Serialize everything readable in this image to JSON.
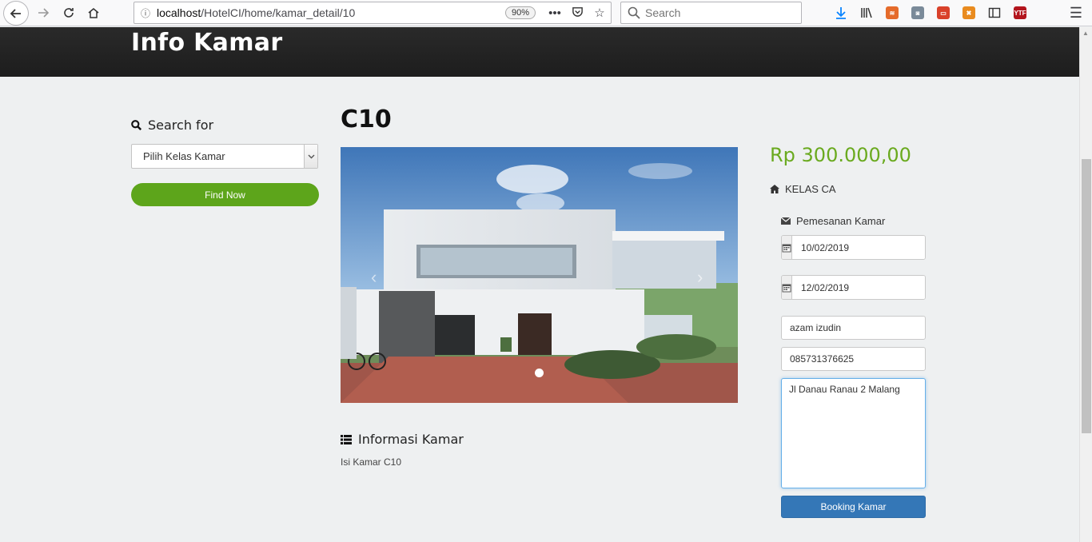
{
  "browser": {
    "url_host": "localhost",
    "url_path": "/HotelCI/home/kamar_detail/10",
    "zoom": "90%",
    "search_placeholder": "Search"
  },
  "page": {
    "header_title": "Info Kamar"
  },
  "sidebar": {
    "search_heading": "Search for",
    "select_value": "Pilih Kelas Kamar",
    "find_button": "Find Now"
  },
  "room": {
    "title": "C10",
    "info_heading": "Informasi Kamar",
    "info_text": "Isi Kamar C10"
  },
  "booking": {
    "price": "Rp 300.000,00",
    "room_class": "KELAS CA",
    "form_heading": "Pemesanan Kamar",
    "checkin_date": "10/02/2019",
    "checkout_date": "12/02/2019",
    "name": "azam izudin",
    "phone": "085731376625",
    "address": "Jl Danau Ranau 2 Malang",
    "submit_label": "Booking Kamar"
  },
  "colors": {
    "accent_green": "#5da51b",
    "price_green": "#6aaa1f",
    "primary_blue": "#3477b7",
    "header_dark": "#1d1d1d"
  }
}
